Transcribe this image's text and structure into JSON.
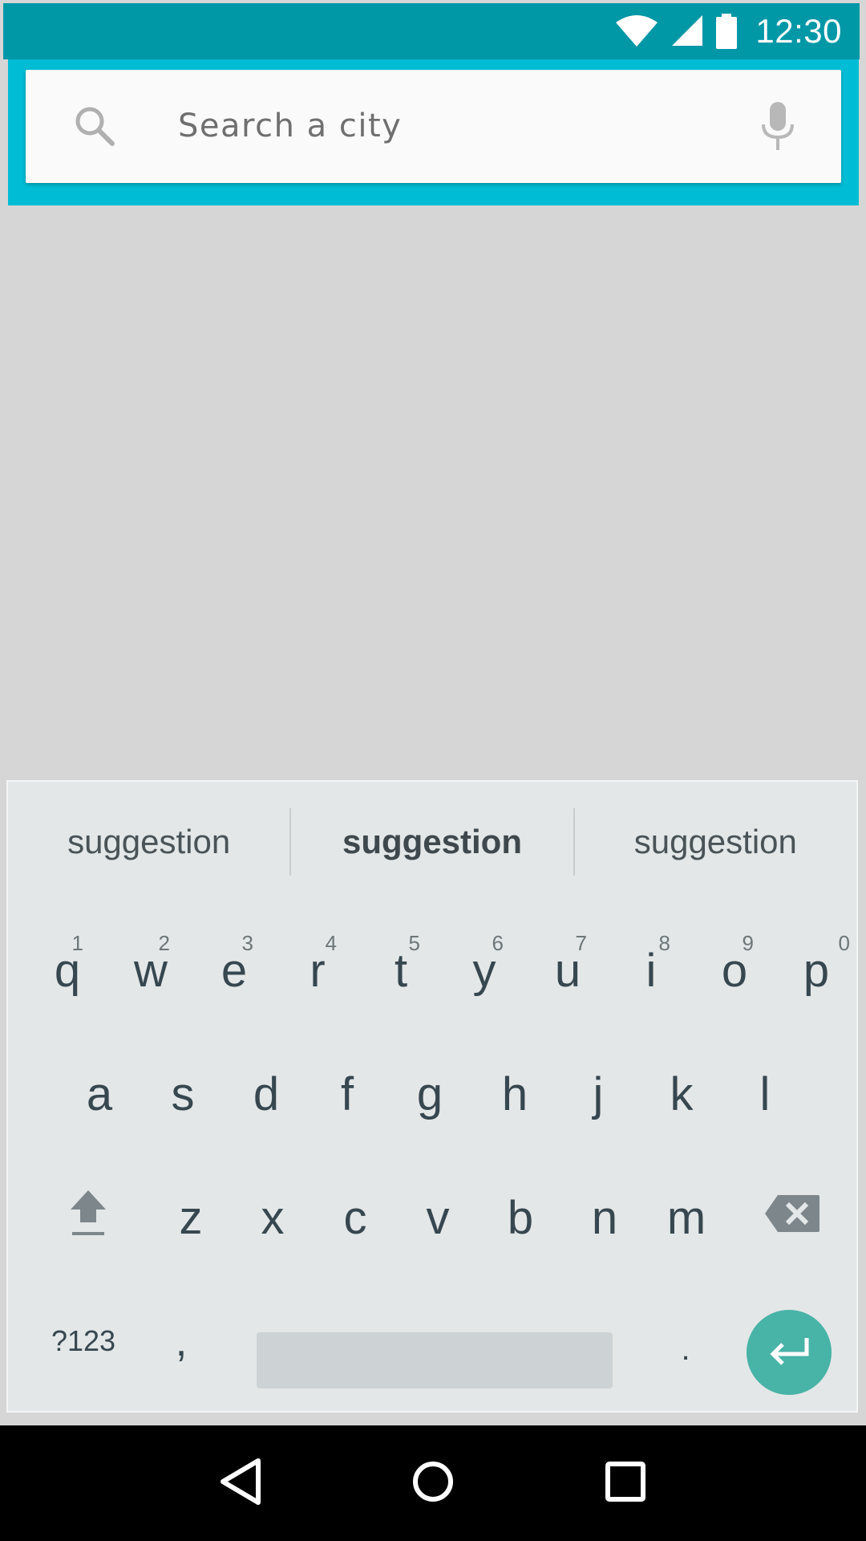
{
  "status_bar": {
    "time": "12:30",
    "icons": [
      "wifi-icon",
      "cell-signal-icon",
      "battery-icon"
    ],
    "background": "#0097a7"
  },
  "search": {
    "placeholder": "Search a city",
    "value": "",
    "header_color": "#00bcd4"
  },
  "keyboard": {
    "suggestions": [
      "suggestion",
      "suggestion",
      "suggestion"
    ],
    "row1": [
      {
        "key": "q",
        "hint": "1"
      },
      {
        "key": "w",
        "hint": "2"
      },
      {
        "key": "e",
        "hint": "3"
      },
      {
        "key": "r",
        "hint": "4"
      },
      {
        "key": "t",
        "hint": "5"
      },
      {
        "key": "y",
        "hint": "6"
      },
      {
        "key": "u",
        "hint": "7"
      },
      {
        "key": "i",
        "hint": "8"
      },
      {
        "key": "o",
        "hint": "9"
      },
      {
        "key": "p",
        "hint": "0"
      }
    ],
    "row2": [
      "a",
      "s",
      "d",
      "f",
      "g",
      "h",
      "j",
      "k",
      "l"
    ],
    "row3": [
      "z",
      "x",
      "c",
      "v",
      "b",
      "n",
      "m"
    ],
    "symbols_label": "?123",
    "comma_label": ",",
    "period_label": ".",
    "enter_color": "#48b3a7"
  },
  "nav_bar": {
    "buttons": [
      "back-icon",
      "home-icon",
      "recents-icon"
    ]
  }
}
